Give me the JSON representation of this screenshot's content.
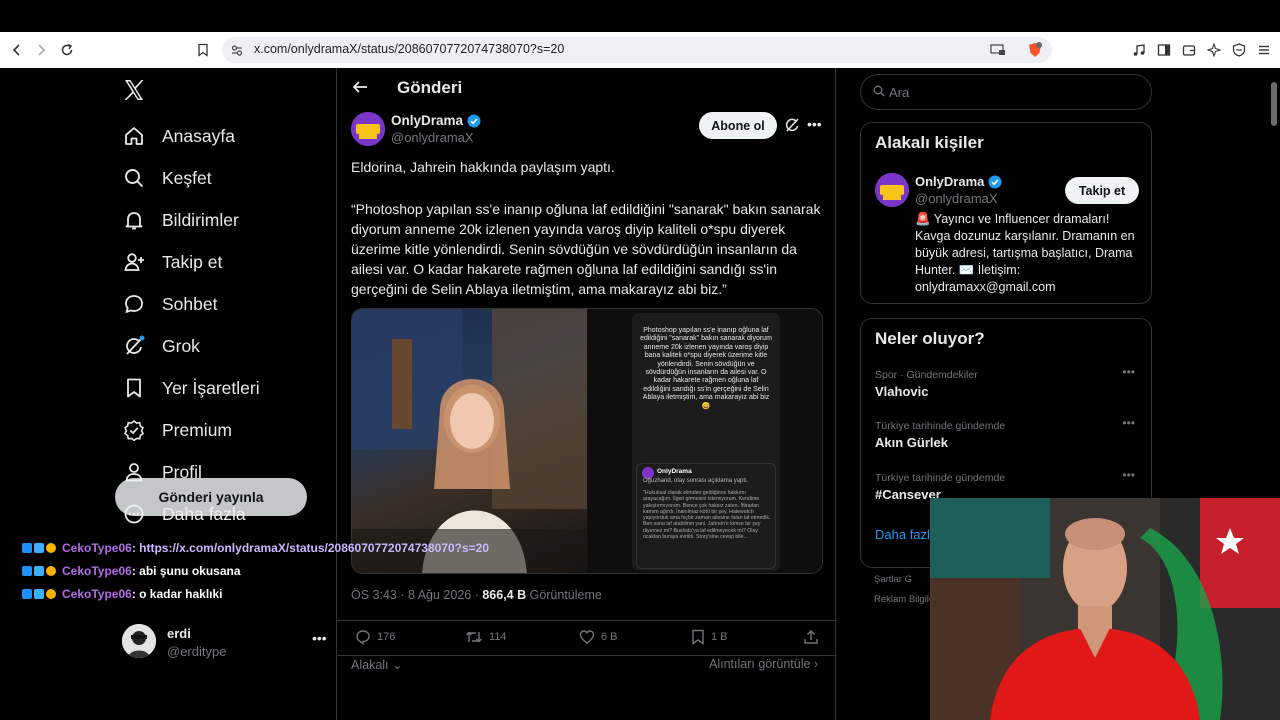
{
  "browser": {
    "url": "x.com/onlydramaX/status/2086070772074738070?s=20"
  },
  "nav": {
    "items": [
      {
        "label": "Anasayfa"
      },
      {
        "label": "Keşfet"
      },
      {
        "label": "Bildirimler"
      },
      {
        "label": "Takip et"
      },
      {
        "label": "Sohbet"
      },
      {
        "label": "Grok"
      },
      {
        "label": "Yer İşaretleri"
      },
      {
        "label": "Premium"
      },
      {
        "label": "Profil"
      },
      {
        "label": "Daha fazla"
      }
    ],
    "post_button": "Gönderi yayınla",
    "user": {
      "name": "erdi",
      "handle": "@erditype"
    }
  },
  "main": {
    "title": "Gönderi",
    "author": {
      "name": "OnlyDrama",
      "handle": "@onlydramaX"
    },
    "subscribe_label": "Abone ol",
    "intro": "Eldorina, Jahrein hakkında paylaşım yaptı.",
    "body": "“Photoshop yapılan ss'e inanıp oğluna laf edildiğini \"sanarak\" bakın sanarak diyorum anneme 20k izlenen yayında varoş diyip kaliteli o*spu diyerek üzerime kitle yönlendirdi. Senin sövdüğün ve sövdürdüğün insanların da ailesi var. O kadar hakarete rağmen oğluna laf edildiğini sandığı ss'in gerçeğini de Selin Ablaya iletmiştim, ama makarayız abi biz.”",
    "media": {
      "phone_text": "Photoshop yapılan ss'e inanıp oğluna laf edildiğini \"sanarak\" bakın sanarak diyorum anneme 20k izlenen yayında varoş diyip bana kaliteli o*spu diyerek üzerime kitle yönlendirdi. Senin sövdüğün ve sövdürdüğün insanların da ailesi var. O kadar hakarete rağmen oğluna laf edildiğini sandığı ss'in gerçeğini de Selin Ablaya iletmiştim, ama makarayız abi biz 😄",
      "quote_name": "OnlyDrama",
      "quote_sub": "Oğuzhand, olay sonrası açıklama yaptı.",
      "quote_body": "\"Hukuksal olarak elimden geldiğince hakkımı arayacağım. İlgeri girmesini istemiyorum. Kendime yakıştırmıyorum. Bence çok haksız zaten. İftiradan kamım ağırdı. İnanılmaz kötü bir şey. Hatewatch yapıyorduk ama hiçbir zaman ailesine falan laf etmedik. Ben sana laf atabilirim yani. Jahrein'e kimse bir şey diyemez mi? Bushido'ya laf edilmeyecek mi? Olay ocaklan buraya evrildi. Story'sine cevap bile..."
    },
    "meta": {
      "time": "ÖS 3:43 · 8 Ağu 2026 · ",
      "views": "866,4 B",
      "views_label": " Görüntüleme"
    },
    "actions": {
      "replies": "176",
      "reposts": "114",
      "likes": "6 B",
      "bookmarks": "1 B"
    },
    "related_label": "Alakalı",
    "see_quotes_label": "Alıntıları görüntüle"
  },
  "right": {
    "search_placeholder": "Ara",
    "relevant_title": "Alakalı kişiler",
    "person": {
      "name": "OnlyDrama",
      "handle": "@onlydramaX",
      "bio": "🚨 Yayıncı ve Influencer dramaları! Kavga dozunuz karşılanır. Dramanın en büyük adresi, tartışma başlatıcı, Drama Hunter. ✉️ İletişim: onlydramaxx@gmail.com",
      "follow_label": "Takip et"
    },
    "trends_title": "Neler oluyor?",
    "trends": [
      {
        "category": "Spor · Gündemdekiler",
        "name": "Vlahovic"
      },
      {
        "category": "Türkiye tarihinde gündemde",
        "name": "Akın Gürlek"
      },
      {
        "category": "Türkiye tarihinde gündemde",
        "name": "#Cansever"
      }
    ],
    "show_more": "Daha fazla",
    "footer1": "Şartlar   G",
    "footer2": "Reklam Bilgile"
  },
  "chat": [
    {
      "user": "CekoType06",
      "message": ": https://x.com/onlydramaX/status/2086070772074738070?s=20"
    },
    {
      "user": "CekoType06",
      "message": ": abi şunu okusana"
    },
    {
      "user": "CekoType06",
      "message": ": o kadar haklıki"
    }
  ]
}
